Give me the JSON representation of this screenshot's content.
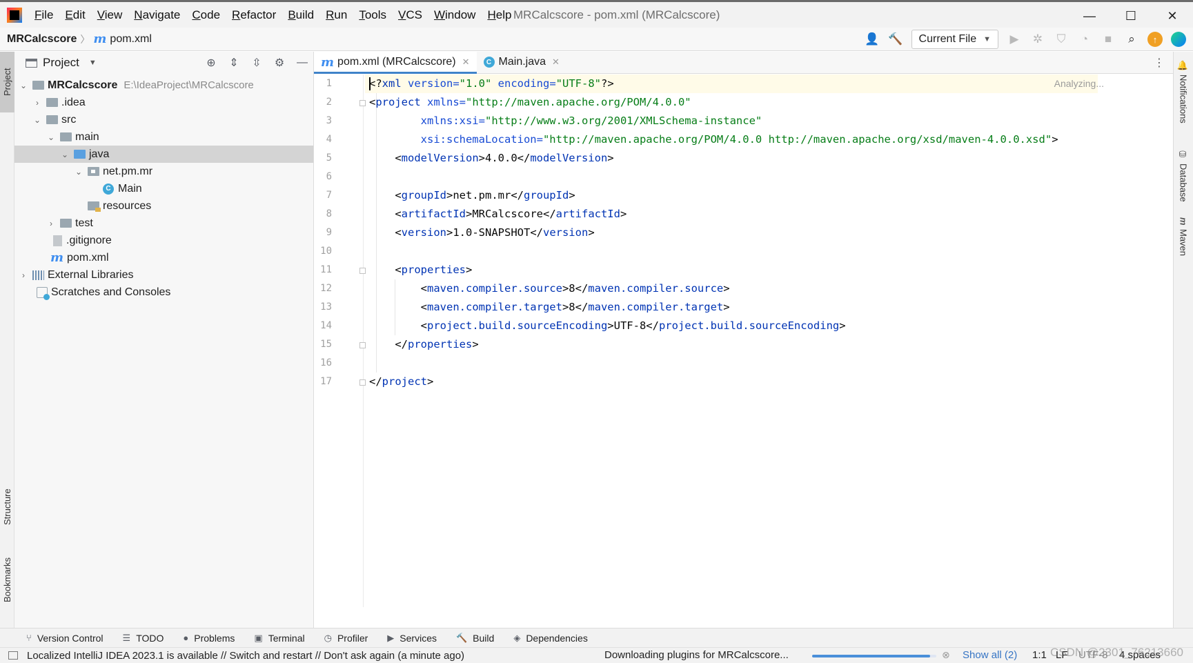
{
  "window": {
    "title": "MRCalcscore - pom.xml (MRCalcscore)",
    "menu": [
      {
        "mnemonic": "F",
        "rest": "ile"
      },
      {
        "mnemonic": "E",
        "rest": "dit"
      },
      {
        "mnemonic": "V",
        "rest": "iew"
      },
      {
        "mnemonic": "N",
        "rest": "avigate"
      },
      {
        "mnemonic": "C",
        "rest": "ode"
      },
      {
        "mnemonic": "R",
        "rest": "efactor"
      },
      {
        "mnemonic": "B",
        "rest": "uild"
      },
      {
        "mnemonic": "R",
        "rest": "un"
      },
      {
        "mnemonic": "T",
        "rest": "ools"
      },
      {
        "mnemonic": "V",
        "rest": "CS"
      },
      {
        "mnemonic": "W",
        "rest": "indow"
      },
      {
        "mnemonic": "H",
        "rest": "elp"
      }
    ],
    "controls": {
      "minimize": "—",
      "maximize": "☐",
      "close": "✕"
    }
  },
  "navbar": {
    "project": "MRCalcscore",
    "file": "pom.xml",
    "run_config": "Current File"
  },
  "left_strip": {
    "project": "Project",
    "structure": "Structure",
    "bookmarks": "Bookmarks"
  },
  "project_panel": {
    "title": "Project",
    "tree": [
      {
        "label": "MRCalcscore",
        "path": "E:\\IdeaProject\\MRCalcscore"
      },
      {
        "label": ".idea"
      },
      {
        "label": "src"
      },
      {
        "label": "main"
      },
      {
        "label": "java"
      },
      {
        "label": "net.pm.mr"
      },
      {
        "label": "Main"
      },
      {
        "label": "resources"
      },
      {
        "label": "test"
      },
      {
        "label": ".gitignore"
      },
      {
        "label": "pom.xml"
      },
      {
        "label": "External Libraries"
      },
      {
        "label": "Scratches and Consoles"
      }
    ]
  },
  "editor": {
    "tabs": [
      {
        "label": "pom.xml (MRCalcscore)",
        "icon": "maven-file-icon",
        "active": true
      },
      {
        "label": "Main.java",
        "icon": "java-class-icon",
        "active": false
      }
    ],
    "status": "Analyzing...",
    "line_numbers": [
      "1",
      "2",
      "3",
      "4",
      "5",
      "6",
      "7",
      "8",
      "9",
      "10",
      "11",
      "12",
      "13",
      "14",
      "15",
      "16",
      "17"
    ],
    "code": {
      "l1": {
        "a": "<?",
        "b": "xml",
        "c": " version=",
        "d": "\"1.0\"",
        "e": " encoding=",
        "f": "\"UTF-8\"",
        "g": "?>"
      },
      "l2": {
        "a": "<",
        "b": "project",
        "c": " xmlns=",
        "d": "\"http://maven.apache.org/POM/4.0.0\""
      },
      "l3": {
        "a": "        ",
        "b": "xmlns:xsi=",
        "c": "\"http://www.w3.org/2001/XMLSchema-instance\""
      },
      "l4": {
        "a": "        ",
        "b": "xsi:schemaLocation=",
        "c": "\"http://maven.apache.org/POM/4.0.0 http://maven.apache.org/xsd/maven-4.0.0.xsd\"",
        "d": ">"
      },
      "l5": {
        "a": "    <",
        "b": "modelVersion",
        "c": ">4.0.0</",
        "d": "modelVersion",
        "e": ">"
      },
      "l7": {
        "a": "    <",
        "b": "groupId",
        "c": ">net.pm.mr</",
        "d": "groupId",
        "e": ">"
      },
      "l8": {
        "a": "    <",
        "b": "artifactId",
        "c": ">MRCalcscore</",
        "d": "artifactId",
        "e": ">"
      },
      "l9": {
        "a": "    <",
        "b": "version",
        "c": ">1.0-SNAPSHOT</",
        "d": "version",
        "e": ">"
      },
      "l11": {
        "a": "    <",
        "b": "properties",
        "c": ">"
      },
      "l12": {
        "a": "        <",
        "b": "maven.compiler.source",
        "c": ">8</",
        "d": "maven.compiler.source",
        "e": ">"
      },
      "l13": {
        "a": "        <",
        "b": "maven.compiler.target",
        "c": ">8</",
        "d": "maven.compiler.target",
        "e": ">"
      },
      "l14": {
        "a": "        <",
        "b": "project.build.sourceEncoding",
        "c": ">UTF-8</",
        "d": "project.build.sourceEncoding",
        "e": ">"
      },
      "l15": {
        "a": "    </",
        "b": "properties",
        "c": ">"
      },
      "l17": {
        "a": "</",
        "b": "project",
        "c": ">"
      }
    }
  },
  "right_strip": {
    "notifications": "Notifications",
    "database": "Database",
    "maven": "Maven"
  },
  "tool_windows": [
    "Version Control",
    "TODO",
    "Problems",
    "Terminal",
    "Profiler",
    "Services",
    "Build",
    "Dependencies"
  ],
  "status_bar": {
    "message": "Localized IntelliJ IDEA 2023.1 is available // Switch and restart // Don't ask again (a minute ago)",
    "progress_text": "Downloading plugins for MRCalcscore...",
    "progress_fraction": 0.95,
    "show_all": "Show all (2)",
    "caret": "1:1",
    "line_separator": "LF",
    "encoding": "UTF-8",
    "indent": "4 spaces",
    "watermark": "CSDN @2301_76213660"
  },
  "colors": {
    "accent": "#4083c9",
    "tag": "#0033b3",
    "attribute": "#174ad4",
    "string": "#067d17"
  }
}
